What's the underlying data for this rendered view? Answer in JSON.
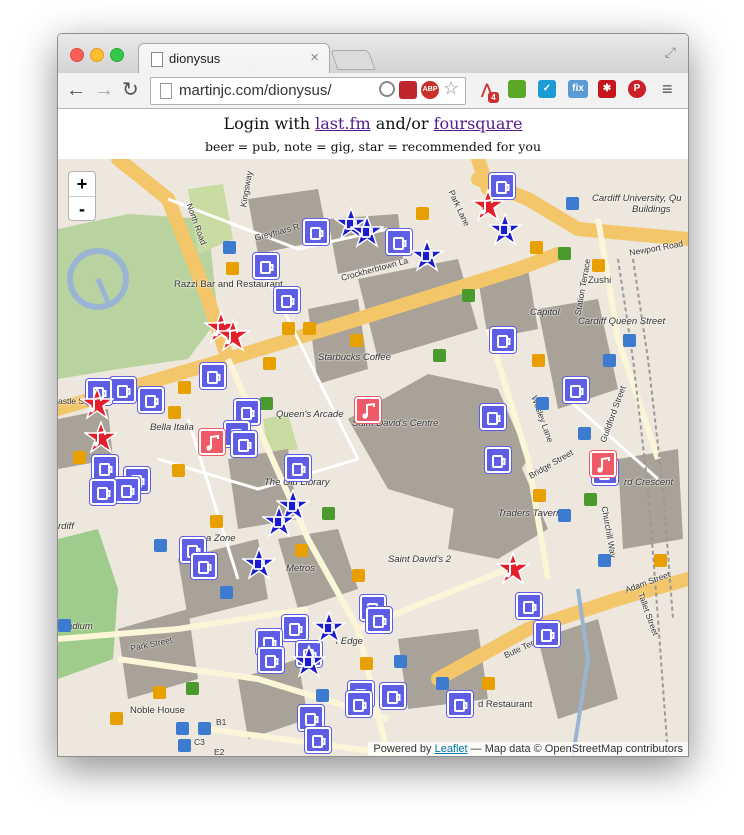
{
  "browser": {
    "tab_title": "dionysus",
    "url": "martinjc.com/dionysus/",
    "extensions": [
      "target-icon",
      "flash-icon",
      "adblock-icon",
      "star-icon",
      "share-icon",
      "evernote-icon",
      "pocket-icon",
      "fix-icon",
      "cloud-icon",
      "pinterest-icon",
      "menu-icon"
    ],
    "share_badge": "4",
    "fix_label": "fix"
  },
  "page": {
    "login_prefix": "Login with ",
    "lastfm": "last.fm",
    "and_or": " and/or ",
    "foursquare": "foursquare",
    "legend": "beer = pub, note = gig, star = recommended for you"
  },
  "map": {
    "zoom_in": "+",
    "zoom_out": "-",
    "attribution_prefix": "Powered by ",
    "attribution_link": "Leaflet",
    "attribution_suffix": " — Map data © OpenStreetMap contributors",
    "labels": {
      "north_road": "North Road",
      "kingsway": "Kingsway",
      "greyfriars": "Greyfriars R",
      "crockherbtown": "Crockherbtown La",
      "park_lane": "Park Lane",
      "cardiff_university": "Cardiff University, Qu",
      "buildings": "Buildings",
      "newport_road": "Newport Road",
      "station_terrace": "Station Terrace",
      "zushi": "Zushi",
      "razzi": "Razzi Bar and Restaurant",
      "capitol": "Capitol",
      "cardiff_queen_street": "Cardiff Queen Street",
      "starbucks": "Starbucks Coffee",
      "queens_arcade": "Queen's Arcade",
      "st_davids_centre": "Saint David's Centre",
      "castle_st": "astle St",
      "bella_italia": "Bella Italia",
      "old_library": "The Old Library",
      "wesley_lane": "Wesley Lane",
      "guildford_street": "Guildford Street",
      "bridge_street": "Bridge Street",
      "crescent": "rd Crescent",
      "traders_tavern": "Traders Tavern",
      "churchill_way": "Churchill Way",
      "cardiff": "rdiff",
      "zone": "a Zone",
      "metros": "Metros",
      "st_davids_2": "Saint David's 2",
      "adam_street": "Adam Street",
      "stadium": "Stadium",
      "park_street": "Park Street",
      "bute_terrace": "Bute Ter",
      "tredegar_street": "Tallet Street",
      "edge": "l Edge",
      "noble_house": "Noble House",
      "restaurant": "d Restaurant",
      "b1": "B1",
      "c3": "C3",
      "e2": "E2"
    }
  }
}
